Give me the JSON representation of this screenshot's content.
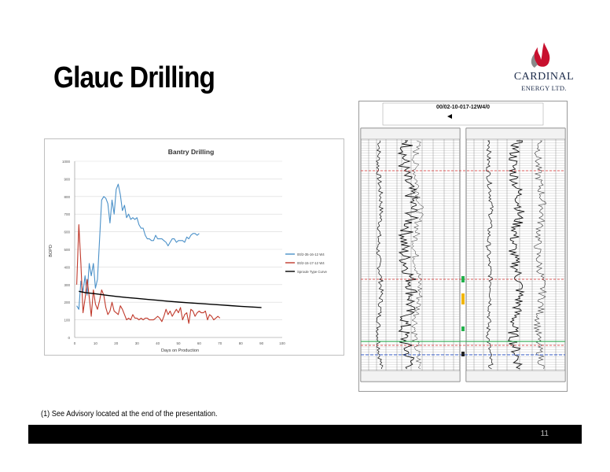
{
  "slide": {
    "title": "Glauc Drilling",
    "footnote": "(1)  See Advisory located at the end of the presentation.",
    "page_number": "11"
  },
  "logo": {
    "name": "CARDINAL",
    "subtitle": "ENERGY LTD."
  },
  "well_log": {
    "header_title": "00/02-10-017-12W4/0"
  },
  "colors": {
    "series1": "#4a90c8",
    "series2": "#c0392b",
    "series3": "#000000",
    "logo_flame": "#c8102e",
    "log_red": "#d93030",
    "log_green": "#22b24c",
    "log_blue": "#3a5fcd"
  },
  "chart_data": {
    "type": "line",
    "title": "Bantry Drilling",
    "xlabel": "Days on Production",
    "ylabel": "BOPD",
    "xlim": [
      0,
      100
    ],
    "ylim": [
      0,
      1000
    ],
    "xticks": [
      "0",
      "10",
      "20",
      "30",
      "40",
      "50",
      "60",
      "70",
      "80",
      "90",
      "100"
    ],
    "yticks": [
      "0",
      "100",
      "200",
      "300",
      "400",
      "500",
      "600",
      "700",
      "800",
      "900",
      "1000"
    ],
    "grid": true,
    "legend_position": "right",
    "series": [
      {
        "name": "00/2-35-16-12 W4",
        "x": [
          1,
          2,
          3,
          4,
          5,
          6,
          7,
          8,
          9,
          10,
          11,
          12,
          13,
          14,
          15,
          16,
          17,
          18,
          19,
          20,
          21,
          22,
          23,
          24,
          25,
          26,
          27,
          28,
          29,
          30,
          31,
          32,
          33,
          34,
          35,
          36,
          37,
          38,
          39,
          40,
          41,
          42,
          43,
          44,
          45,
          46,
          47,
          48,
          49,
          50,
          51,
          52,
          53,
          54,
          55,
          56,
          57,
          58,
          59,
          60
        ],
        "y": [
          180,
          160,
          320,
          260,
          350,
          240,
          420,
          350,
          420,
          280,
          330,
          560,
          780,
          800,
          790,
          760,
          650,
          780,
          700,
          840,
          870,
          810,
          720,
          750,
          680,
          700,
          670,
          680,
          670,
          680,
          640,
          620,
          620,
          580,
          560,
          560,
          550,
          550,
          580,
          560,
          560,
          560,
          550,
          540,
          520,
          540,
          560,
          560,
          540,
          550,
          550,
          550,
          540,
          570,
          560,
          580,
          590,
          590,
          580,
          590
        ]
      },
      {
        "name": "00/2-15-17-12 W4",
        "x": [
          1,
          2,
          3,
          4,
          5,
          6,
          7,
          8,
          9,
          10,
          11,
          12,
          13,
          14,
          15,
          16,
          17,
          18,
          19,
          20,
          21,
          22,
          23,
          24,
          25,
          26,
          27,
          28,
          29,
          30,
          31,
          32,
          33,
          34,
          35,
          36,
          37,
          38,
          39,
          40,
          41,
          42,
          43,
          44,
          45,
          46,
          47,
          48,
          49,
          50,
          51,
          52,
          53,
          54,
          55,
          56,
          57,
          58,
          59,
          60,
          61,
          62,
          63,
          64,
          65,
          66,
          67,
          68,
          69,
          70
        ],
        "y": [
          300,
          640,
          420,
          140,
          220,
          330,
          230,
          120,
          270,
          190,
          160,
          210,
          270,
          240,
          170,
          130,
          150,
          200,
          150,
          140,
          130,
          180,
          160,
          130,
          100,
          110,
          100,
          130,
          110,
          110,
          100,
          110,
          100,
          110,
          110,
          100,
          100,
          100,
          110,
          120,
          110,
          90,
          120,
          160,
          130,
          150,
          120,
          140,
          160,
          140,
          170,
          100,
          130,
          140,
          80,
          160,
          150,
          120,
          140,
          150,
          140,
          140,
          150,
          100,
          130,
          120,
          100,
          110,
          120,
          110
        ]
      },
      {
        "name": "Sproule Type Curve",
        "x": [
          2,
          5,
          10,
          15,
          20,
          25,
          30,
          35,
          40,
          45,
          50,
          55,
          60,
          65,
          70,
          75,
          80,
          85,
          90
        ],
        "y": [
          262,
          255,
          248,
          240,
          233,
          227,
          222,
          216,
          211,
          206,
          201,
          197,
          193,
          189,
          185,
          181,
          177,
          173,
          170
        ]
      }
    ]
  }
}
